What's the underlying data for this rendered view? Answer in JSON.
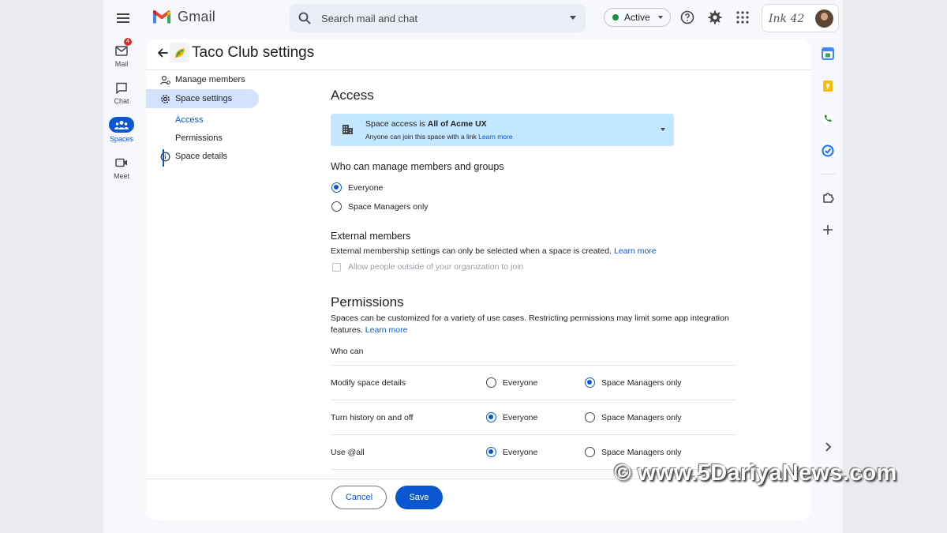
{
  "header": {
    "app_name": "Gmail",
    "search_placeholder": "Search mail and chat",
    "status_label": "Active",
    "brand_text": "Ink 42"
  },
  "rail": [
    {
      "label": "Mail",
      "badge": "4"
    },
    {
      "label": "Chat"
    },
    {
      "label": "Spaces",
      "active": true
    },
    {
      "label": "Meet"
    }
  ],
  "page": {
    "title": "Taco Club settings",
    "emoji": "🌮"
  },
  "nav": {
    "manage_members": "Manage members",
    "space_settings": "Space settings",
    "sub_access": "Access",
    "sub_permissions": "Permissions",
    "space_details": "Space details"
  },
  "access": {
    "heading": "Access",
    "banner_prefix": "Space access is ",
    "banner_value": "All of Acme UX",
    "banner_line2": "Anyone can join this space with a link ",
    "banner_link": "Learn more"
  },
  "manage": {
    "heading": "Who can manage members and groups",
    "options": [
      "Everyone",
      "Space Managers only"
    ],
    "selected": "Everyone"
  },
  "external": {
    "heading": "External members",
    "description": "External membership settings can only be selected when a space is created. ",
    "link": "Learn more",
    "checkbox_label": "Allow people outside of your organization to join"
  },
  "permissions": {
    "heading": "Permissions",
    "description": "Spaces can be customized for a variety of use cases. Restricting permissions may limit some app integration features. ",
    "link": "Learn more",
    "who_can": "Who can",
    "option_everyone": "Everyone",
    "option_managers": "Space Managers only",
    "rows": [
      {
        "label": "Modify space details",
        "selected": "Space Managers only"
      },
      {
        "label": "Turn history on and off",
        "selected": "Everyone"
      },
      {
        "label": "Use @all",
        "selected": "Everyone"
      }
    ]
  },
  "footer": {
    "cancel": "Cancel",
    "save": "Save"
  },
  "watermark": "© www.5DariyaNews.com",
  "colors": {
    "accent": "#0b57d0",
    "banner_bg": "#c2e7ff",
    "nav_selected_bg": "#d3e3fd",
    "status_dot": "#1e8e3e"
  }
}
